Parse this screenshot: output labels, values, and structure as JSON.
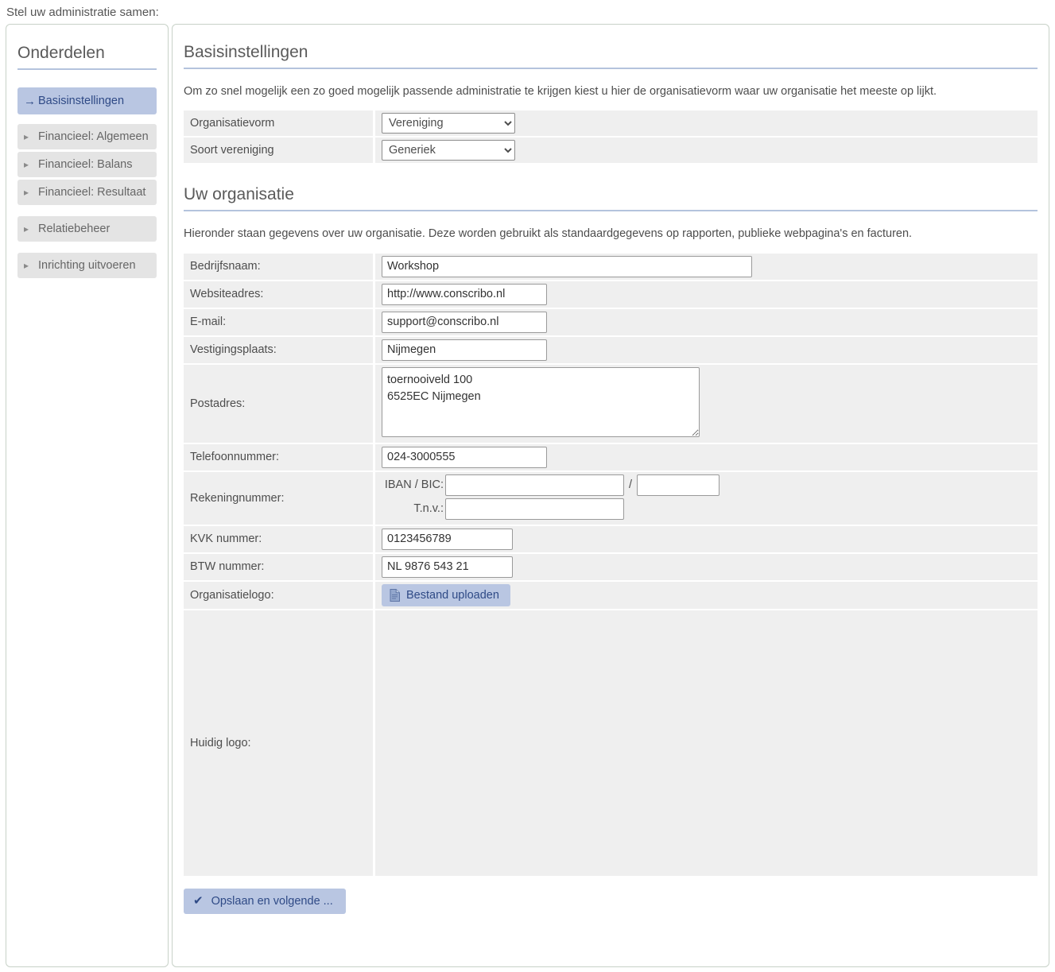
{
  "page": {
    "intro": "Stel uw administratie samen:"
  },
  "sidebar": {
    "title": "Onderdelen",
    "items": [
      {
        "label": "Basisinstellingen",
        "icon": "arrow-right-icon",
        "glyph": "→",
        "active": true
      },
      {
        "label": "Financieel: Algemeen",
        "icon": "triangle-right-icon",
        "glyph": "▸",
        "active": false
      },
      {
        "label": "Financieel: Balans",
        "icon": "triangle-right-icon",
        "glyph": "▸",
        "active": false
      },
      {
        "label": "Financieel: Resultaat",
        "icon": "triangle-right-icon",
        "glyph": "▸",
        "active": false
      },
      {
        "label": "Relatiebeheer",
        "icon": "triangle-right-icon",
        "glyph": "▸",
        "active": false
      },
      {
        "label": "Inrichting uitvoeren",
        "icon": "triangle-right-icon",
        "glyph": "▸",
        "active": false
      }
    ]
  },
  "basic": {
    "title": "Basisinstellingen",
    "description": "Om zo snel mogelijk een zo goed mogelijk passende administratie te krijgen kiest u hier de organisatievorm waar uw organisatie het meeste op lijkt.",
    "org_form_label": "Organisatievorm",
    "org_form_value": "Vereniging",
    "org_form_options": [
      "Vereniging"
    ],
    "assoc_type_label": "Soort vereniging",
    "assoc_type_value": "Generiek",
    "assoc_type_options": [
      "Generiek"
    ]
  },
  "organisation": {
    "title": "Uw organisatie",
    "description": "Hieronder staan gegevens over uw organisatie. Deze worden gebruikt als standaardgegevens op rapporten, publieke webpagina's en facturen.",
    "fields": {
      "company_name_label": "Bedrijfsnaam:",
      "company_name_value": "Workshop",
      "website_label": "Websiteadres:",
      "website_value": "http://www.conscribo.nl",
      "email_label": "E-mail:",
      "email_value": "support@conscribo.nl",
      "city_label": "Vestigingsplaats:",
      "city_value": "Nijmegen",
      "postal_label": "Postadres:",
      "postal_value": "toernooiveld 100\n6525EC Nijmegen",
      "phone_label": "Telefoonnummer:",
      "phone_value": "024-3000555",
      "account_label": "Rekeningnummer:",
      "iban_label": "IBAN / BIC:",
      "iban_value": "",
      "bic_value": "",
      "tnv_label": "T.n.v.:",
      "tnv_value": "",
      "kvk_label": "KVK nummer:",
      "kvk_value": "0123456789",
      "btw_label": "BTW nummer:",
      "btw_value": "NL 9876 543 21",
      "logo_label": "Organisatielogo:",
      "upload_button": "Bestand uploaden",
      "current_logo_label": "Huidig logo:",
      "current_logo_value": ""
    }
  },
  "footer": {
    "save_label": "Opslaan en volgende ...",
    "save_icon": "check-icon"
  },
  "colors": {
    "accent": "#b9c6e2",
    "accent_text": "#2f4a86",
    "row_bg": "#efefef",
    "panel_border": "#c8d2c8",
    "heading_rule": "#b4c3dd"
  }
}
